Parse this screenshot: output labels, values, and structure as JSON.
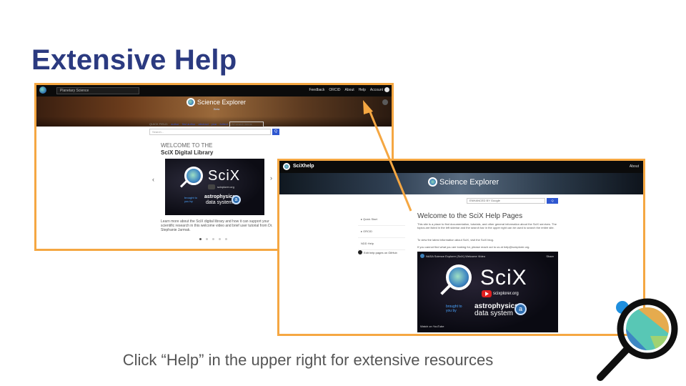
{
  "slide": {
    "title": "Extensive Help",
    "caption": "Click “Help” in the upper right for extensive resources"
  },
  "screenshot1": {
    "logo_text": "SciX",
    "collection_select": "Planetary Science",
    "nav": [
      "Feedback",
      "ORCID",
      "About",
      "Help",
      "Account"
    ],
    "brand": "Science Explorer",
    "brand_sub": "Beta",
    "quick_field_label": "QUICK FIELD:",
    "quick_fields": [
      "author",
      "first author",
      "abstract",
      "year",
      "fulltext"
    ],
    "all_fields_select": "All search terms",
    "search_placeholder": "Search...",
    "search_button": "Q",
    "welcome": "WELCOME TO THE",
    "library": "SciX Digital Library",
    "video": {
      "title": "SciX",
      "url": "scixplorer.org",
      "brought_1": "brought to",
      "brought_2": "you by",
      "astro": "astrophysics",
      "data_system": "data system",
      "a": "a"
    },
    "description": "Learn more about the SciX digital library and how it can support your scientific research in this welcome video and brief user tutorial from Dr. Stephanie Jarmak.",
    "carousel_prev": "‹",
    "carousel_next": "›"
  },
  "screenshot2": {
    "logo_text": "SciXhelp",
    "about": "About",
    "brand": "Science Explorer",
    "search_placeholder": "ENHANCED BY Google",
    "search_button": "Q",
    "sidebar": [
      "▸ Quick Start",
      "▸ ORCID",
      "NDD Help"
    ],
    "github_link": "Edit help pages on GitHub",
    "heading": "Welcome to the SciX Help Pages",
    "para1": "This site is a place to find documentation, tutorials, and other general information about the SciX services. The topics are listed in the left sidebar and the search bar in the upper right can be used to search the entire site.",
    "para2": "To view the latest information about SciX, visit the SciX blog.",
    "para3": "If you cannot find what you are looking for, please reach out to us at help@scixplorer.org.",
    "video": {
      "top_label": "NASA Science Explorer (SciX) Welcome Video",
      "share": "Share",
      "title": "SciX",
      "url": "scixplorer.org",
      "brought_1": "brought to",
      "brought_2": "you by",
      "astro": "astrophysics",
      "data_system": "data system",
      "a": "a",
      "watch_on": "Watch on YouTube"
    }
  },
  "colors": {
    "title": "#2b3a80",
    "frame": "#f5a742",
    "arrow": "#f5a742",
    "caption": "#555555"
  },
  "icons": [
    "scix-logo-icon",
    "search-icon",
    "play-icon",
    "github-icon",
    "magnifier-logo-icon"
  ]
}
